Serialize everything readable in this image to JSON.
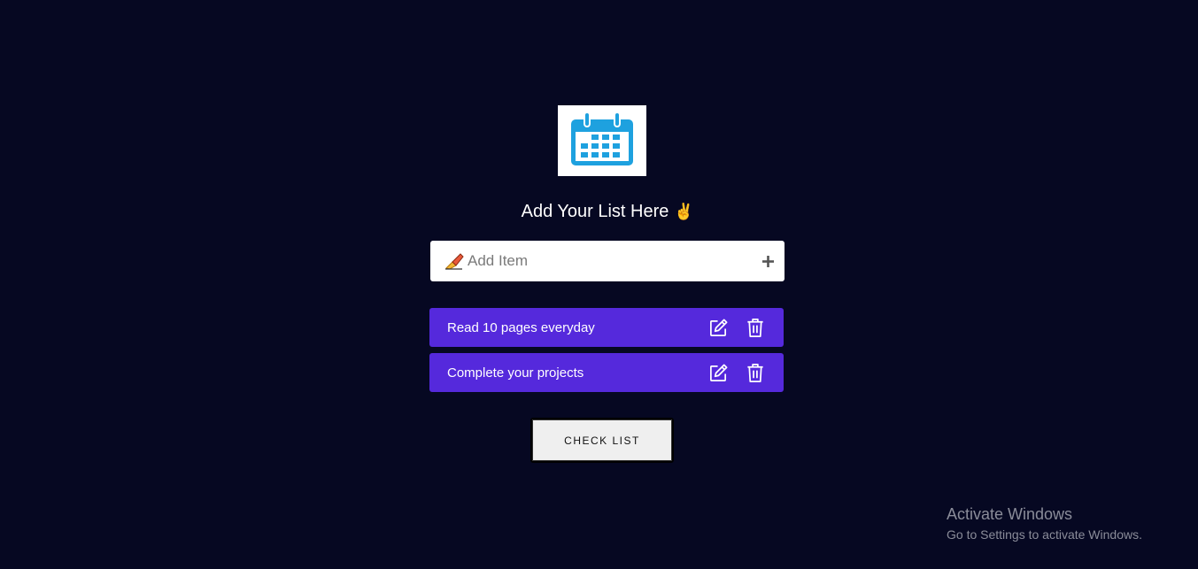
{
  "header": {
    "logo_icon": "calendar-icon",
    "title": "Add Your List Here",
    "title_emoji": "✌"
  },
  "add_item": {
    "leading_icon": "writing-hand-icon",
    "placeholder": "Add Item",
    "value": "",
    "add_icon": "plus-icon"
  },
  "items": [
    {
      "label": "Read 10 pages everyday",
      "edit_icon": "edit-icon",
      "delete_icon": "trash-icon"
    },
    {
      "label": "Complete your projects",
      "edit_icon": "edit-icon",
      "delete_icon": "trash-icon"
    }
  ],
  "actions": {
    "check_list_label": "CHECK LIST"
  },
  "watermark": {
    "title": "Activate Windows",
    "subtitle": "Go to Settings to activate Windows."
  },
  "colors": {
    "background": "#060822",
    "item_background": "#5529dc",
    "logo_blue": "#1ea1df"
  }
}
